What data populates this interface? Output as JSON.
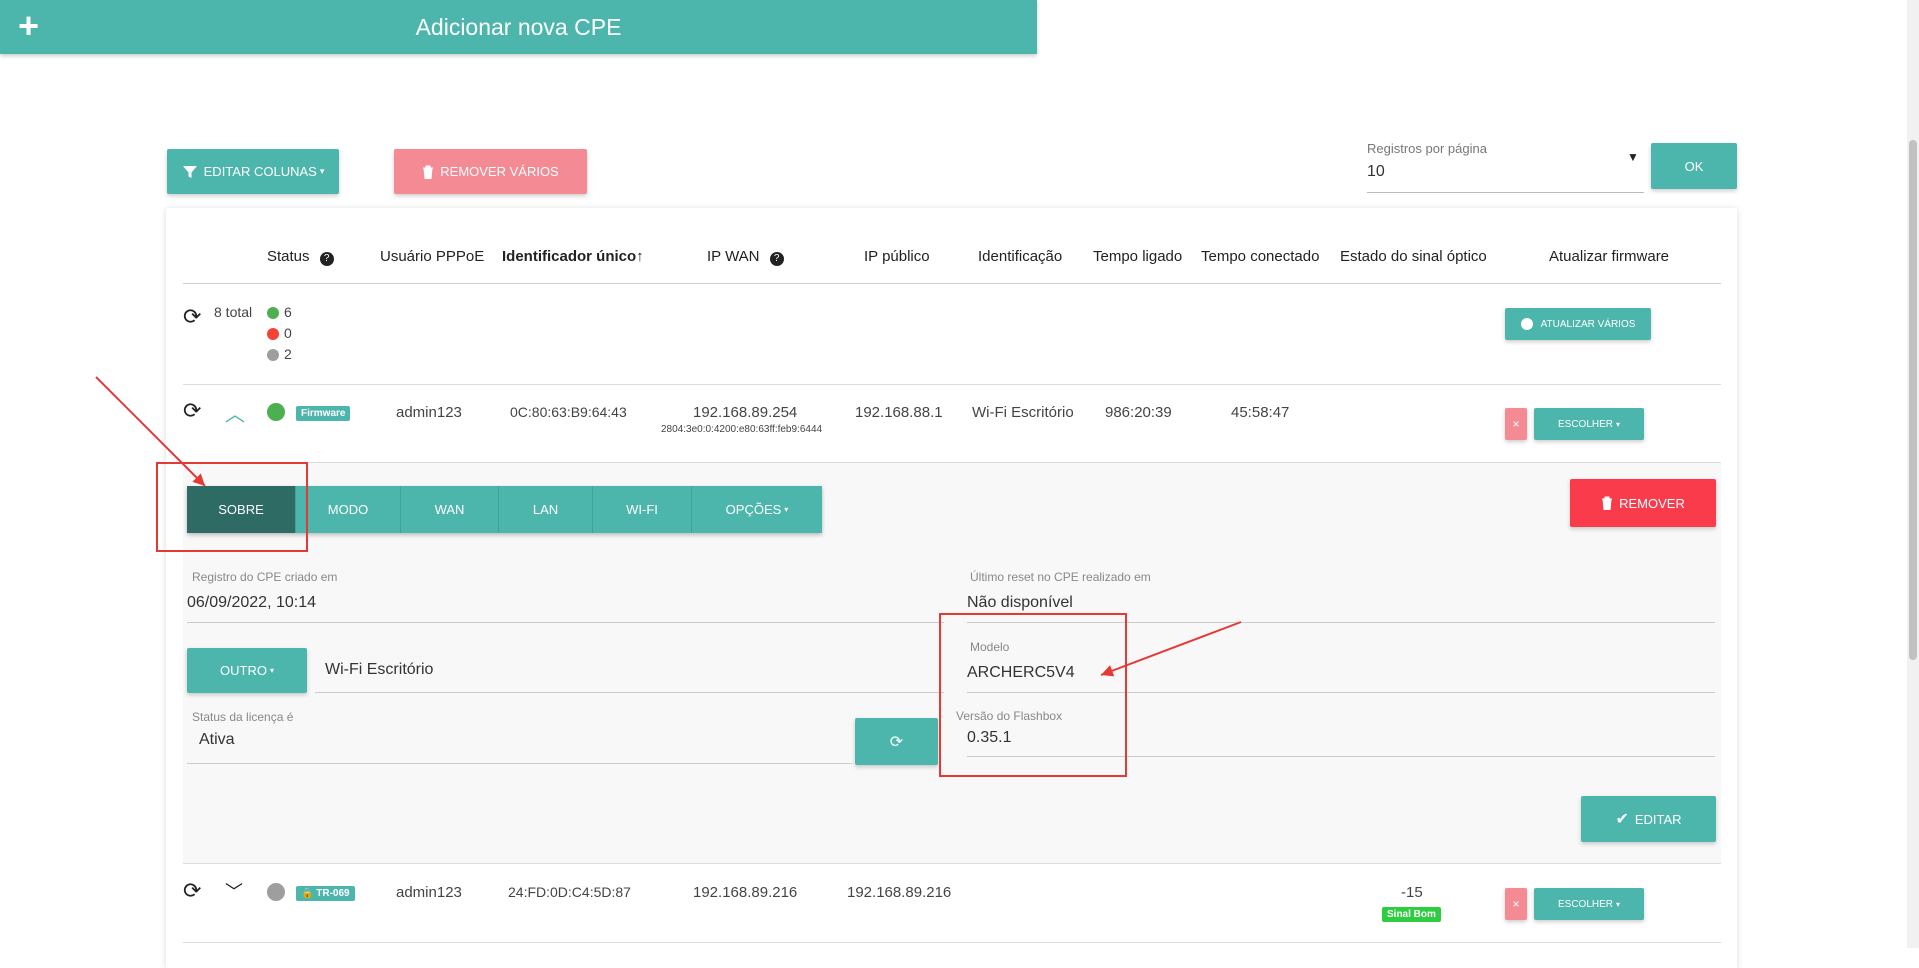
{
  "add_button": {
    "label": "Adicionar nova CPE",
    "icon": "plus-icon"
  },
  "toolbar": {
    "edit_columns": "EDITAR COLUNAS",
    "remove_many": "REMOVER VÁRIOS",
    "per_page_label": "Registros por página",
    "per_page_value": "10",
    "ok": "OK"
  },
  "table": {
    "headers": [
      "Status",
      "Usuário PPPoE",
      "Identificador único↑",
      "IP WAN",
      "IP público",
      "Identificação",
      "Tempo ligado",
      "Tempo conectado",
      "Estado do sinal óptico",
      "Atualizar firmware"
    ],
    "summary": {
      "total": "8 total",
      "online": "6",
      "offline": "0",
      "unknown": "2",
      "update_many": "ATUALIZAR VÁRIOS"
    },
    "rows": [
      {
        "badge": "Firmware",
        "user": "admin123",
        "id": "0C:80:63:B9:64:43",
        "ip_wan": "192.168.89.254",
        "ipv6": "2804:3e0:0:4200:e80:63ff:feb9:6444",
        "ip_public": "192.168.88.1",
        "identification": "Wi-Fi Escritório",
        "uptime": "986:20:39",
        "connected": "45:58:47",
        "choose": "ESCOLHER",
        "status_color": "#4caf50"
      },
      {
        "badge": "TR-069",
        "user": "admin123",
        "id": "24:FD:0D:C4:5D:87",
        "ip_wan": "192.168.89.216",
        "ip_public": "192.168.89.216",
        "signal": "-15",
        "signal_label": "Sinal Bom",
        "choose": "ESCOLHER",
        "status_color": "#9e9e9e"
      }
    ]
  },
  "detail": {
    "tabs": [
      "SOBRE",
      "MODO",
      "WAN",
      "LAN",
      "WI-FI",
      "OPÇÕES"
    ],
    "remove": "REMOVER",
    "created_label": "Registro do CPE criado em",
    "created_value": "06/09/2022, 10:14",
    "reset_label": "Último reset no CPE realizado em",
    "reset_value": "Não disponível",
    "other": "OUTRO",
    "identification_value": "Wi-Fi Escritório",
    "model_label": "Modelo",
    "model_value": "ARCHERC5V4",
    "license_label": "Status da licença é",
    "license_value": "Ativa",
    "flashbox_label": "Versão do Flashbox",
    "flashbox_value": "0.35.1",
    "edit": "EDITAR"
  },
  "colors": {
    "teal": "#4db6ac",
    "dark_teal": "#2e6b64",
    "pink": "#f48a94",
    "red": "#f93b4b",
    "green": "#4caf50",
    "grey": "#9e9e9e"
  }
}
